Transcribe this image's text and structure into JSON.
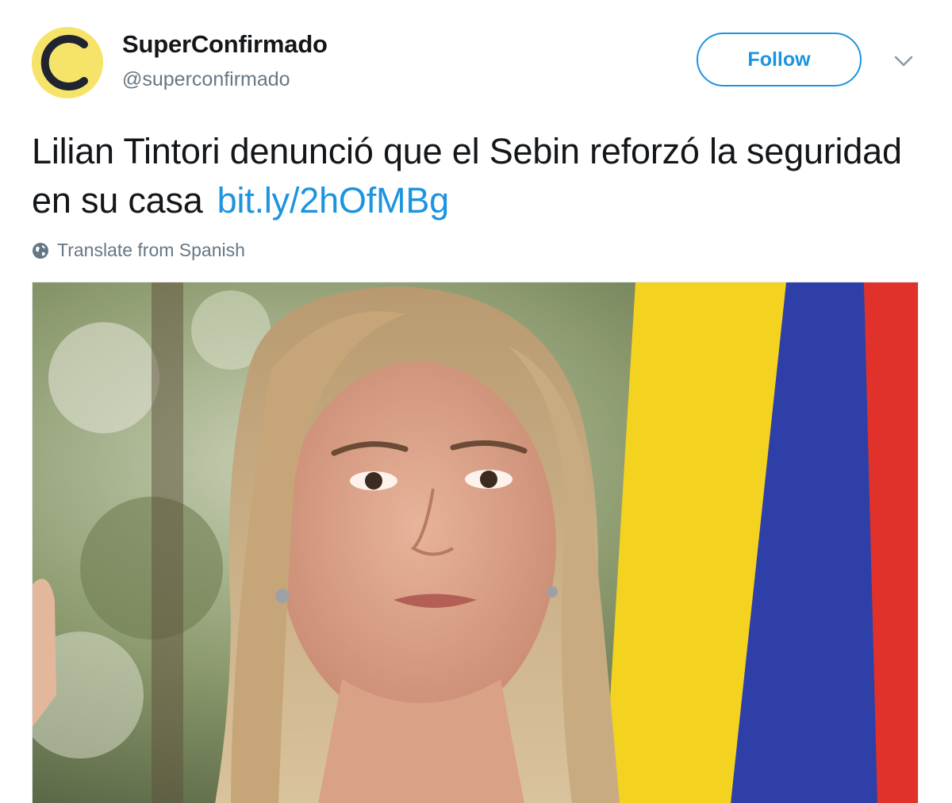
{
  "user": {
    "display_name": "SuperConfirmado",
    "screen_name": "@superconfirmado",
    "avatar_icon": "superconfirmado-c-logo",
    "avatar_colors": {
      "background": "#f6e46a",
      "letter": "#1f2430"
    }
  },
  "actions": {
    "follow_label": "Follow",
    "more_icon": "chevron-down-icon"
  },
  "tweet": {
    "text": "Lilian Tintori denunció que el Sebin reforzó la seguridad en su casa",
    "link_text": "bit.ly/2hOfMBg",
    "translate_label": "Translate from Spanish",
    "translate_icon": "globe-icon"
  },
  "media": {
    "type": "photo",
    "subject": "woman-portrait-with-flag"
  },
  "colors": {
    "accent": "#1c94e0",
    "text_primary": "#14171a",
    "text_secondary": "#657786"
  }
}
